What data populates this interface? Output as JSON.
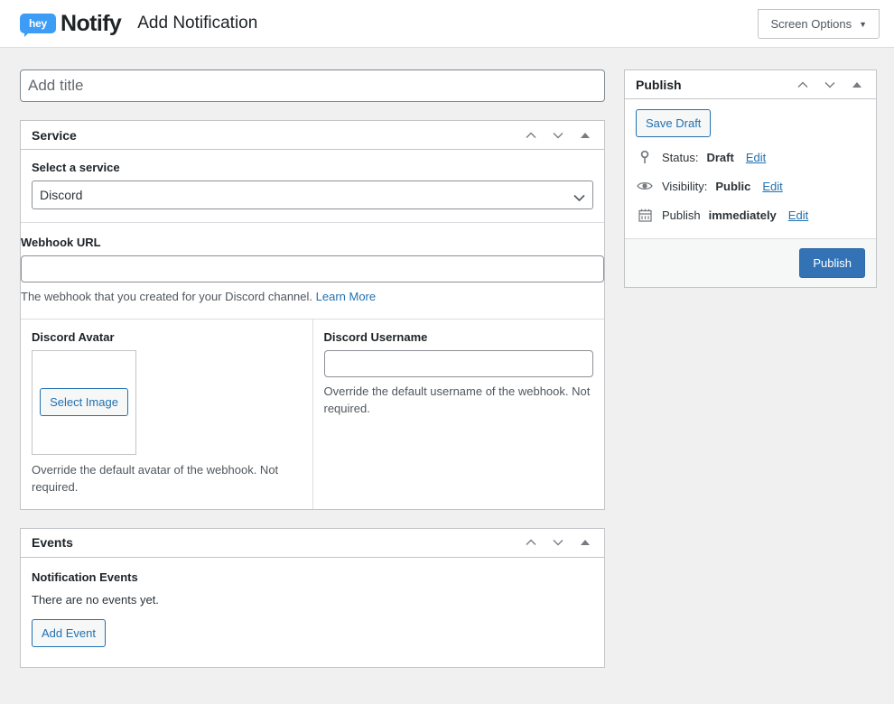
{
  "header": {
    "logo_text": "hey",
    "brand_name": "Notify",
    "page_title": "Add Notification",
    "screen_options_label": "Screen Options",
    "screen_options_caret": "▼"
  },
  "colors": {
    "accent_blue": "#2271b1",
    "publish_blue": "#3373b5",
    "logo_blue": "#3d9cf5",
    "page_background": "#f0f0f1",
    "panel_border": "#c3c4c7"
  },
  "title_field": {
    "placeholder": "Add title",
    "value": ""
  },
  "panels": {
    "service": {
      "heading": "Service",
      "select_label": "Select a service",
      "selected_service": "Discord",
      "service_options": [
        "Discord"
      ],
      "webhook_label": "Webhook URL",
      "webhook_value": "",
      "webhook_help": "The webhook that you created for your Discord channel.",
      "webhook_help_link": "Learn More",
      "avatar_label": "Discord Avatar",
      "avatar_button": "Select Image",
      "avatar_help": "Override the default avatar of the webhook. Not required.",
      "username_label": "Discord Username",
      "username_value": "",
      "username_help": "Override the default username of the webhook. Not required."
    },
    "events": {
      "heading": "Events",
      "subheading": "Notification Events",
      "empty_text": "There are no events yet.",
      "add_button": "Add Event"
    },
    "publish": {
      "heading": "Publish",
      "save_draft_label": "Save Draft",
      "status_label": "Status:",
      "status_value": "Draft",
      "status_edit": "Edit",
      "visibility_label": "Visibility:",
      "visibility_value": "Public",
      "visibility_edit": "Edit",
      "schedule_label": "Publish",
      "schedule_value": "immediately",
      "schedule_edit": "Edit",
      "publish_button": "Publish"
    }
  }
}
